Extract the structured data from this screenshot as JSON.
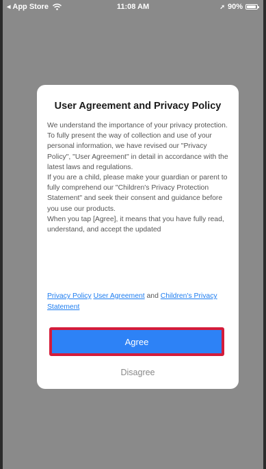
{
  "status_bar": {
    "back_label": "App Store",
    "time": "11:08 AM",
    "battery": "90%",
    "battery_level": 0.9,
    "icons": [
      "back-arrow-icon",
      "wifi-icon",
      "location-icon",
      "battery-icon"
    ]
  },
  "dialog": {
    "title": "User Agreement and Privacy Policy",
    "paragraphs": [
      "We understand the importance of your privacy protection. To fully present the way of collection and use of your personal information, we have revised our \"Privacy Policy\", \"User Agreement\" in detail in accordance with the latest laws and regulations.",
      "If you are a child, please make your guardian or parent to fully comprehend our \"Children's Privacy Protection Statement\" and seek their consent and guidance before you use our products.",
      "When you tap [Agree], it means that you have fully read, understand, and accept the updated"
    ],
    "links": {
      "privacy_policy": "Privacy Policy",
      "user_agreement": "User Agreement",
      "and_text": "and",
      "childrens_statement": "Children's Privacy Statement"
    },
    "agree_label": "Agree",
    "disagree_label": "Disagree"
  },
  "colors": {
    "overlay": "#8a8a8a",
    "link": "#1c7cf0",
    "agree_button": "#2d82f6",
    "highlight_border": "#d41c3a",
    "disagree_text": "#888888"
  }
}
